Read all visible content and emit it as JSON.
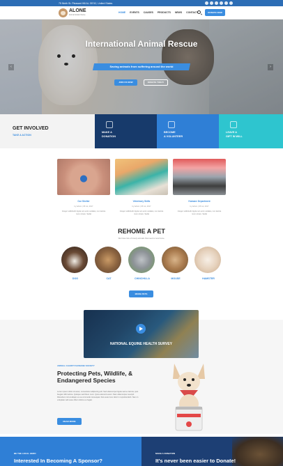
{
  "topbar": {
    "address": "75 Ninth St. Pleasant Hill AL 35742, United States",
    "social_icons": [
      "facebook-icon",
      "twitter-icon",
      "google-plus-icon",
      "instagram-icon",
      "linkedin-icon",
      "rss-icon"
    ]
  },
  "header": {
    "brand": "ALONE",
    "tagline": "Animal shelter theme",
    "nav": [
      "HOME",
      "EVENTS",
      "CAUSES",
      "PRODUCTS",
      "NEWS",
      "CONTACT"
    ],
    "active_nav": "HOME",
    "donate_label": "DONATE NOW"
  },
  "hero": {
    "title": "International Animal Rescue",
    "subtitle": "Saving animals from suffering around the world",
    "btn_primary": "JOIN US NOW",
    "btn_secondary": "DONATE TODAY",
    "prev": "‹",
    "next": "›"
  },
  "involve": {
    "title": "GET INVOLVED",
    "subtitle": "TAKE A ACTION",
    "items": [
      {
        "label": "MAKE A\nDONATION",
        "icon": "donation-icon",
        "color": "#173a6b"
      },
      {
        "label": "BECOME\nA VOLUNTEER",
        "icon": "volunteer-icon",
        "color": "#2f7fd6"
      },
      {
        "label": "LEAVE A\nGIFT IN WILL",
        "icon": "gift-icon",
        "color": "#2ec5cf"
      }
    ]
  },
  "cards": [
    {
      "title": "Our Shelter",
      "meta": "by Admin   |   05 Jul, 2017",
      "desc": "Integer sollicitudin ligula non enim sodales, non lacinia nunc ornare. Sedal"
    },
    {
      "title": "Veterinary Skills",
      "meta": "by Admin   |   05 Jul, 2017",
      "desc": "Integer sollicitudin ligula non enim sodales, non lacinia nunc ornare. Sedal"
    },
    {
      "title": "Humane Department",
      "meta": "by Admin   |   05 Jul, 2017",
      "desc": "Integer sollicitudin ligula non enim sodales, non lacinia nunc ornare. Sedal"
    }
  ],
  "rehome": {
    "title": "REHOME A PET",
    "subtitle": "We have lots of lovely animals that need a new home.",
    "pets": [
      "DOG",
      "CAT",
      "CHINCHILLA",
      "MOUSE",
      "HAMSTER"
    ],
    "more_label": "MORE PETS"
  },
  "video": {
    "caption": "NATIONAL EQUINE HEALTH SURVEY"
  },
  "protect": {
    "kicker": "ANIMAL CHARITY/HUMANE SOCIETY",
    "title": "Protecting Pets, Wildlife, & Endangered Species",
    "body": "Lorem ipsum dolor sit amet, consectetur adipiscing elit. Sed ullamcorper ligula sed ex lacinia, quis feugiat nibh lacinia. Quisque sed libero nunc. Quis euismod eusmi. Nam ullamcorper suscipit bibendum nisl at aliquip ex ea commodo consequat. Duis aute irure dolor in reprehenderit. Nam in voluptate velit esse cillum dolore eu fugiat.",
    "btn": "READ MORE"
  },
  "bottom": {
    "sponsor_kicker": "BE THE LOCAL HERO",
    "sponsor_title": "Interested In Becoming A Sponsor?",
    "donate_kicker": "MAKE A DONATION",
    "donate_title": "It's never been easier to Donate!"
  }
}
